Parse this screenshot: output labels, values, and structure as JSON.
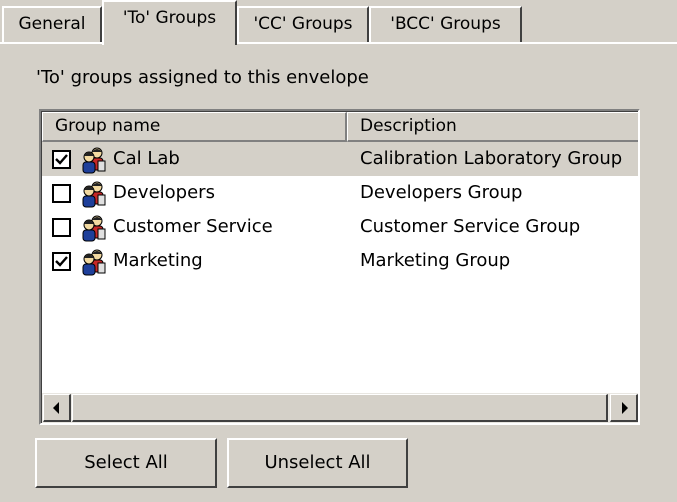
{
  "tabs": [
    {
      "label": "General"
    },
    {
      "label": "'To' Groups",
      "active": true
    },
    {
      "label": "'CC' Groups"
    },
    {
      "label": "'BCC' Groups"
    }
  ],
  "panel": {
    "caption": "'To' groups assigned to this envelope",
    "columns": [
      "Group name",
      "Description"
    ],
    "rows": [
      {
        "name": "Cal Lab",
        "description": "Calibration Laboratory Group",
        "checked": true,
        "selected": true
      },
      {
        "name": "Developers",
        "description": "Developers Group",
        "checked": false
      },
      {
        "name": "Customer Service",
        "description": "Customer Service Group",
        "checked": false
      },
      {
        "name": "Marketing",
        "description": "Marketing Group",
        "checked": true
      }
    ]
  },
  "buttons": {
    "select_all": "Select All",
    "unselect_all": "Unselect All"
  },
  "icons": {
    "group": "group-icon",
    "checkbox": "checkbox-icon",
    "scroll_left": "scroll-left-arrow-icon",
    "scroll_right": "scroll-right-arrow-icon"
  }
}
